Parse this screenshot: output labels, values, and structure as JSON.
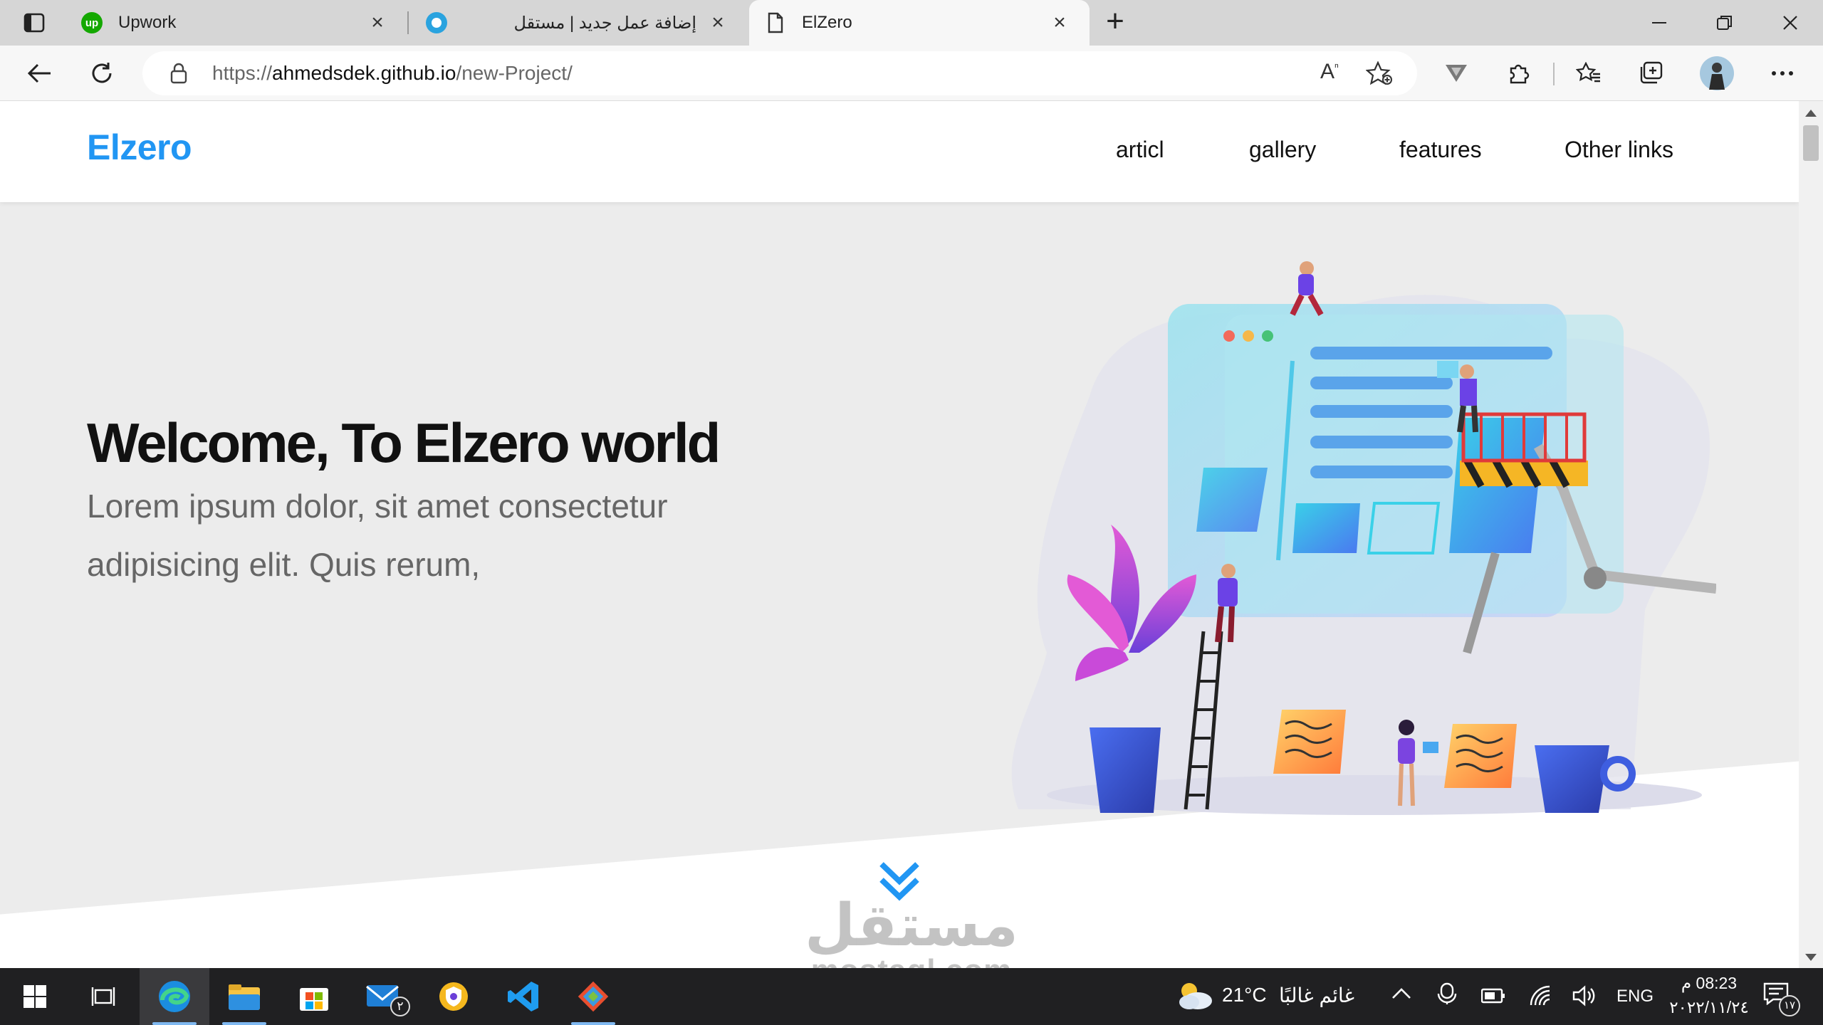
{
  "browser": {
    "tabs": [
      {
        "title": "Upwork",
        "icon": "upwork-icon",
        "active": false
      },
      {
        "title": "إضافة عمل جديد | مستقل",
        "icon": "mostaql-icon",
        "active": false
      },
      {
        "title": "ElZero",
        "icon": "page-icon",
        "active": true
      }
    ],
    "url_prefix": "https://",
    "url_host": "ahmedsdek.github.io",
    "url_path": "/new-Project/",
    "accent": "#2196f3"
  },
  "site": {
    "logo": "Elzero",
    "nav": [
      "articl",
      "gallery",
      "features",
      "Other links"
    ],
    "hero": {
      "title": "Welcome, To Elzero world",
      "text": "Lorem ipsum dolor, sit amet consectetur adipisicing elit. Quis rerum,"
    },
    "watermark": {
      "arabic": "مستقل",
      "latin": "mostaql.com"
    }
  },
  "taskbar": {
    "apps": [
      "start-icon",
      "task-view-icon",
      "edge-icon",
      "file-explorer-icon",
      "store-icon",
      "mail-icon",
      "vpn-icon",
      "vscode-icon",
      "git-icon"
    ],
    "mail_badge": "٢",
    "weather": {
      "temp": "21°C",
      "condition": "غائم غالبًا"
    },
    "language": "ENG",
    "time": "08:23 م",
    "date": "٢٠٢٢/١١/٢٤",
    "notifications_badge": "١٧"
  }
}
